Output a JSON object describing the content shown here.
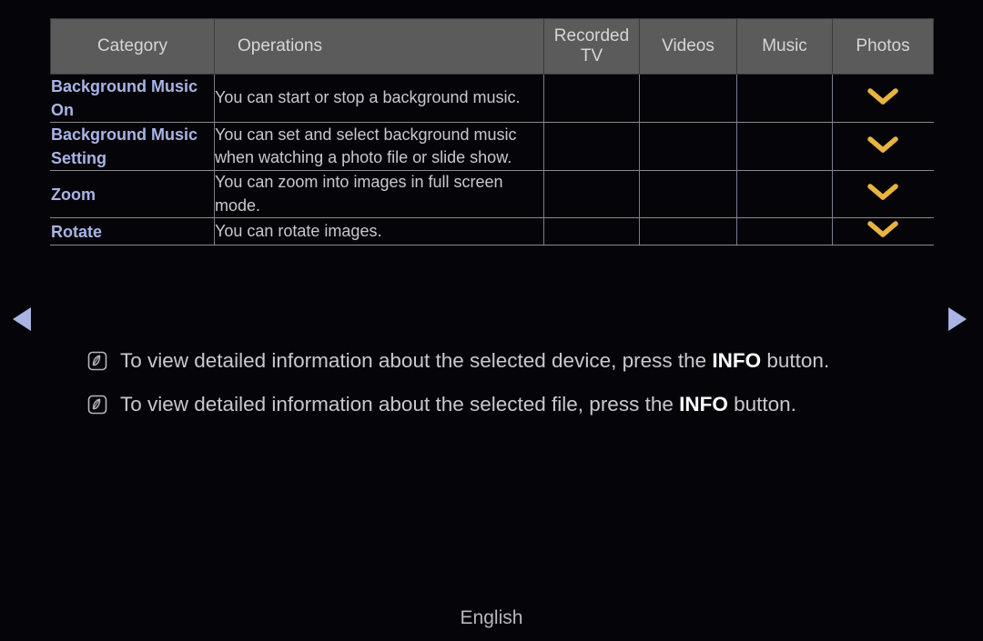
{
  "nav": {
    "left_arrow": "previous-page-arrow",
    "right_arrow": "next-page-arrow"
  },
  "table": {
    "headers": {
      "category": "Category",
      "operations": "Operations",
      "recorded_tv": "Recorded TV",
      "videos": "Videos",
      "music": "Music",
      "photos": "Photos"
    },
    "mark_glyph": "chevron-down-mark",
    "mark_color": "#e9b341",
    "rows": [
      {
        "category": "Background Music On",
        "operations": "You can start or stop a background music.",
        "recorded_tv": "",
        "videos": "",
        "music": "",
        "photos": "chevron"
      },
      {
        "category": "Background Music Setting",
        "operations": "You can set and select background music when watching a photo file or slide show.",
        "recorded_tv": "",
        "videos": "",
        "music": "",
        "photos": "chevron"
      },
      {
        "category": "Zoom",
        "operations": "You can zoom into images in full screen mode.",
        "recorded_tv": "",
        "videos": "",
        "music": "",
        "photos": "chevron"
      },
      {
        "category": "Rotate",
        "operations": "You can rotate images.",
        "recorded_tv": "",
        "videos": "",
        "music": "",
        "photos": "chevron"
      }
    ]
  },
  "notes": [
    {
      "icon": "note-icon",
      "before": "To view detailed information about the selected device, press the ",
      "emphasis": "INFO",
      "after": " button."
    },
    {
      "icon": "note-icon",
      "before": "To view detailed information about the selected file, press the ",
      "emphasis": "INFO",
      "after": " button."
    }
  ],
  "footer": {
    "language": "English"
  },
  "colors": {
    "background": "#050509",
    "header_bg": "#5b5b5b",
    "category_text": "#a9b4e4",
    "body_text": "#c9c9cd",
    "mark": "#e9b341",
    "arrow": "#a9b4e4"
  }
}
